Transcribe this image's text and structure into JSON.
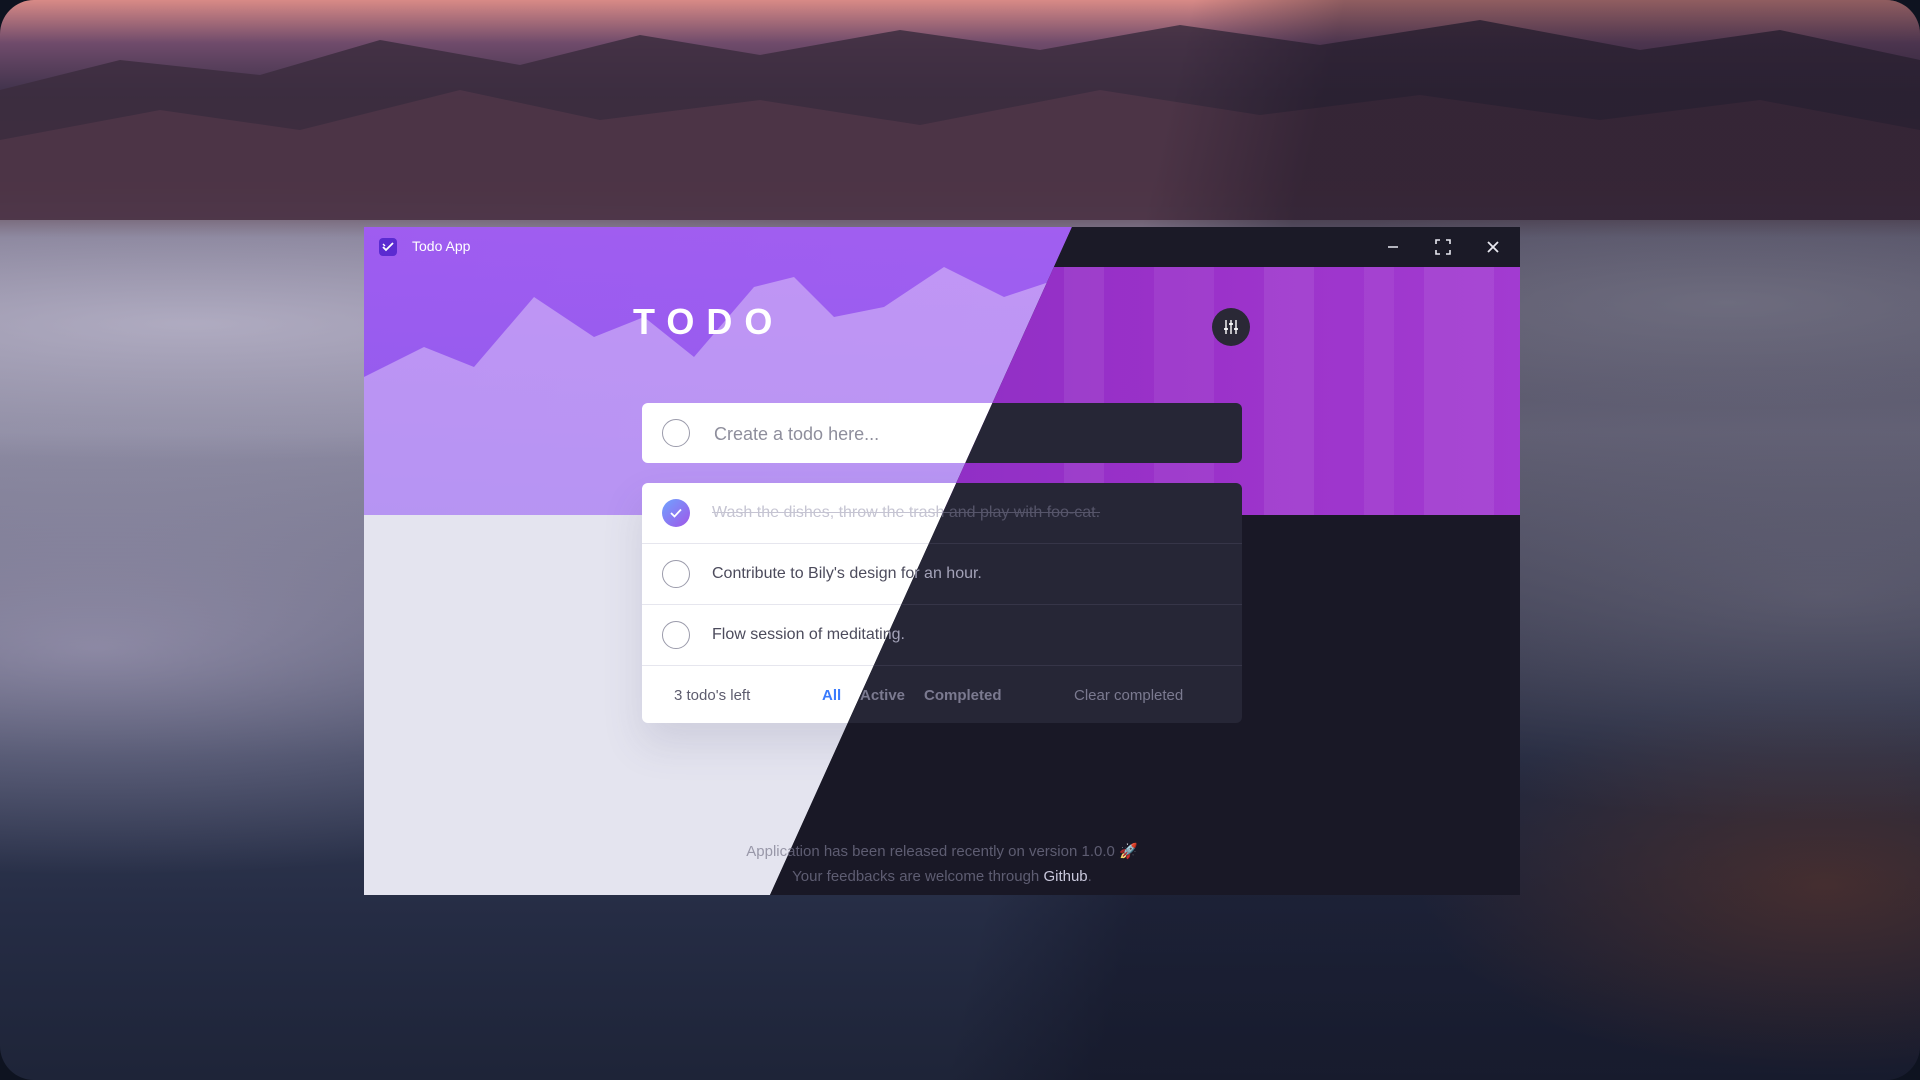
{
  "window": {
    "title": "Todo App"
  },
  "app": {
    "heading": "TODO"
  },
  "new_todo": {
    "placeholder": "Create a todo here..."
  },
  "todos": [
    {
      "text": "Wash the dishes, throw the trash and play with foo-cat.",
      "completed": true
    },
    {
      "text": "Contribute to Bily's design for an hour.",
      "completed": false
    },
    {
      "text": "Flow session of meditating.",
      "completed": false
    }
  ],
  "footer_bar": {
    "items_left": "3 todo's left",
    "filters": {
      "all": "All",
      "active": "Active",
      "completed": "Completed"
    },
    "clear": "Clear completed"
  },
  "page_footer": {
    "line1": "Application has been released recently on version 1.0.0",
    "rocket": "🚀",
    "line2_prefix": "Your feedbacks are welcome through",
    "link": "Github",
    "line2_suffix": "."
  },
  "colors": {
    "accent": "#3a7bfd",
    "check_gradient_start": "#6fa3ff",
    "check_gradient_end": "#a056e8"
  }
}
